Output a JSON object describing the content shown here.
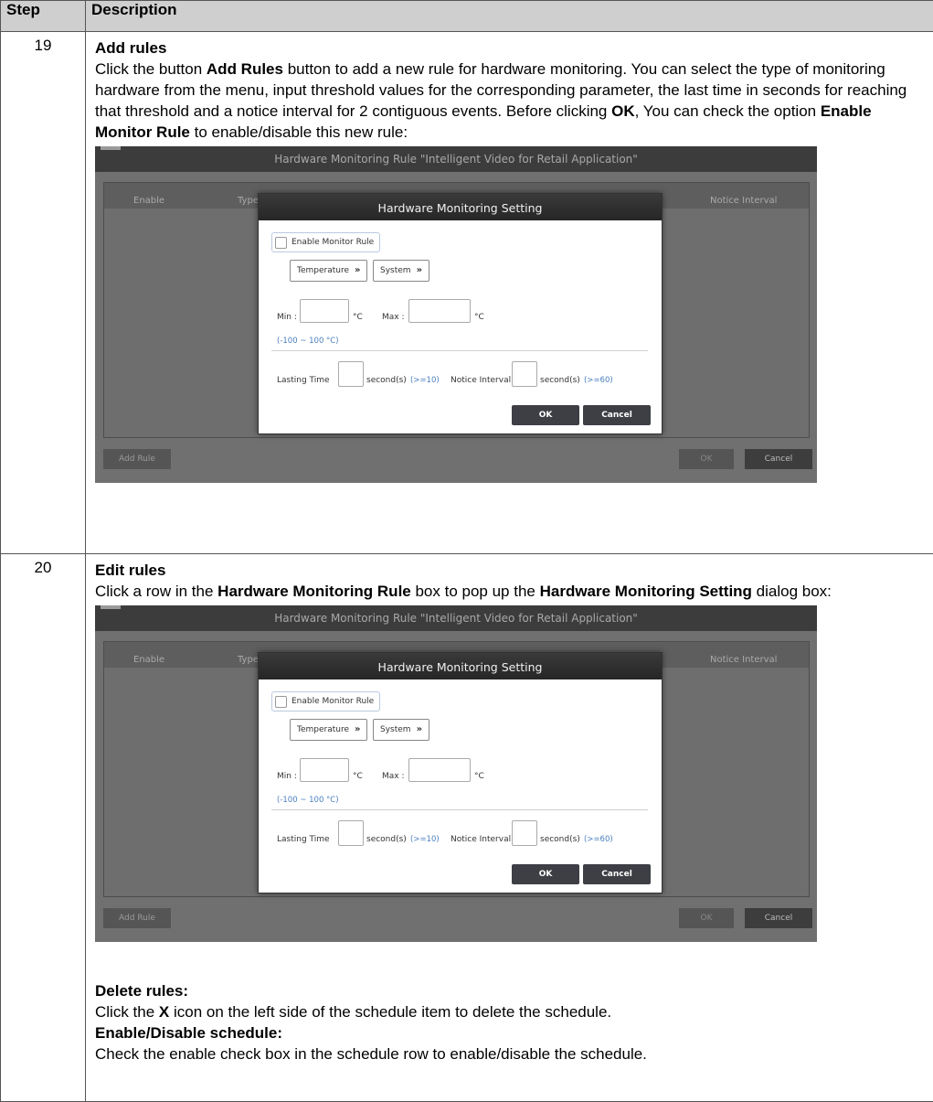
{
  "table": {
    "header": {
      "step": "Step",
      "description": "Description"
    },
    "rows": [
      {
        "step": "19",
        "title": "Add rules",
        "para": {
          "t1": "Click the button ",
          "b1": "Add Rules",
          "t2": " button to add a new rule for hardware monitoring. You can select the type of monitoring hardware from the menu, input threshold values for the corresponding parameter, the last time in seconds for reaching that threshold and a notice interval for 2 contiguous events. Before clicking ",
          "b2": "OK",
          "t3": ", You can check the option ",
          "b3": "Enable Monitor Rule",
          "t4": " to enable/disable this new rule:"
        }
      },
      {
        "step": "20",
        "title": "Edit rules",
        "para": {
          "t1": "Click a row in the ",
          "b1": "Hardware Monitoring Rule",
          "t2": " box to pop up the ",
          "b2": "Hardware Monitoring Setting",
          "t3": " dialog box:"
        },
        "delete_title": "Delete rules:",
        "delete_text_1": "Click the ",
        "delete_bold": "X",
        "delete_text_2": " icon on the left side of the schedule item to delete the schedule.",
        "enable_title": "Enable/Disable schedule:",
        "enable_text": "Check the enable check box in the schedule row to enable/disable the schedule."
      }
    ]
  },
  "screenshot": {
    "window_title": "Hardware Monitoring Rule \"Intelligent Video for Retail Application\"",
    "columns": [
      "Enable",
      "Type",
      "Notice Interval"
    ],
    "add_rule": "Add Rule",
    "ok": "OK",
    "cancel": "Cancel",
    "dialog": {
      "title": "Hardware Monitoring Setting",
      "enable_label": "Enable Monitor Rule",
      "type_select": "Temperature",
      "source_select": "System",
      "min_label": "Min :",
      "max_label": "Max :",
      "unit": "°C",
      "range_hint": "(-100 ~ 100 °C)",
      "lasting_label": "Lasting Time",
      "seconds_label": "second(s)",
      "lasting_hint": "(>=10)",
      "notice_label": "Notice Interval",
      "notice_hint": "(>=60)",
      "ok": "OK",
      "cancel": "Cancel"
    }
  }
}
